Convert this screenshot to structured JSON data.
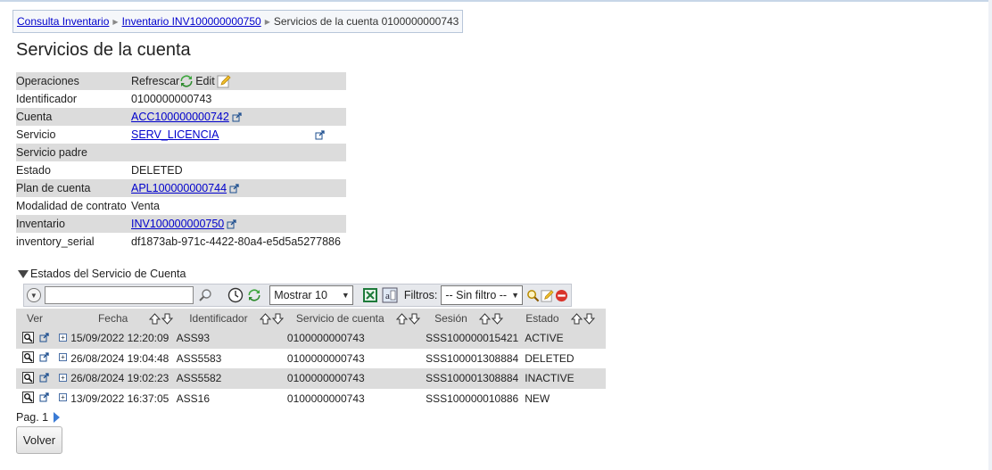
{
  "breadcrumb": {
    "items": [
      "Consulta Inventario",
      "Inventario INV100000000750"
    ],
    "current": "Servicios de la cuenta 0100000000743"
  },
  "page_title": "Servicios de la cuenta",
  "details": {
    "operaciones": {
      "label": "Operaciones",
      "refresh": "Refrescar",
      "edit": "Edit"
    },
    "identificador": {
      "label": "Identificador",
      "value": "0100000000743"
    },
    "cuenta": {
      "label": "Cuenta",
      "value": "ACC100000000742"
    },
    "servicio": {
      "label": "Servicio",
      "value": "SERV_LICENCIA"
    },
    "servicio_padre": {
      "label": "Servicio padre",
      "value": ""
    },
    "estado": {
      "label": "Estado",
      "value": "DELETED"
    },
    "plan": {
      "label": "Plan de cuenta",
      "value": "APL100000000744"
    },
    "modalidad": {
      "label": "Modalidad de contrato",
      "value": "Venta"
    },
    "inventario": {
      "label": "Inventario",
      "value": "INV100000000750"
    },
    "serial": {
      "label": "inventory_serial",
      "value": "df1873ab-971c-4422-80a4-e5d5a5277886"
    }
  },
  "section": {
    "title": "Estados del Servicio de Cuenta"
  },
  "toolbar": {
    "search_value": "",
    "page_size": "Mostrar 10",
    "filters_label": "Filtros:",
    "filter_value": "-- Sin filtro --"
  },
  "table": {
    "columns": [
      "Ver",
      "Fecha",
      "Identificador",
      "Servicio de cuenta",
      "Sesión",
      "Estado"
    ],
    "rows": [
      {
        "fecha": "15/09/2022 12:20:09",
        "id": "ASS93",
        "servicio": "0100000000743",
        "sesion": "SSS100000015421",
        "estado": "ACTIVE"
      },
      {
        "fecha": "26/08/2024 19:04:48",
        "id": "ASS5583",
        "servicio": "0100000000743",
        "sesion": "SSS100001308884",
        "estado": "DELETED"
      },
      {
        "fecha": "26/08/2024 19:02:23",
        "id": "ASS5582",
        "servicio": "0100000000743",
        "sesion": "SSS100001308884",
        "estado": "INACTIVE"
      },
      {
        "fecha": "13/09/2022 16:37:05",
        "id": "ASS16",
        "servicio": "0100000000743",
        "sesion": "SSS100000010886",
        "estado": "NEW"
      }
    ]
  },
  "pager": {
    "label": "Pag. 1"
  },
  "footer": {
    "back_label": "Volver"
  },
  "colors": {
    "link": "#0000cc",
    "row_shade": "#dcdcdc",
    "pager_arrow": "#3a7bd5"
  }
}
